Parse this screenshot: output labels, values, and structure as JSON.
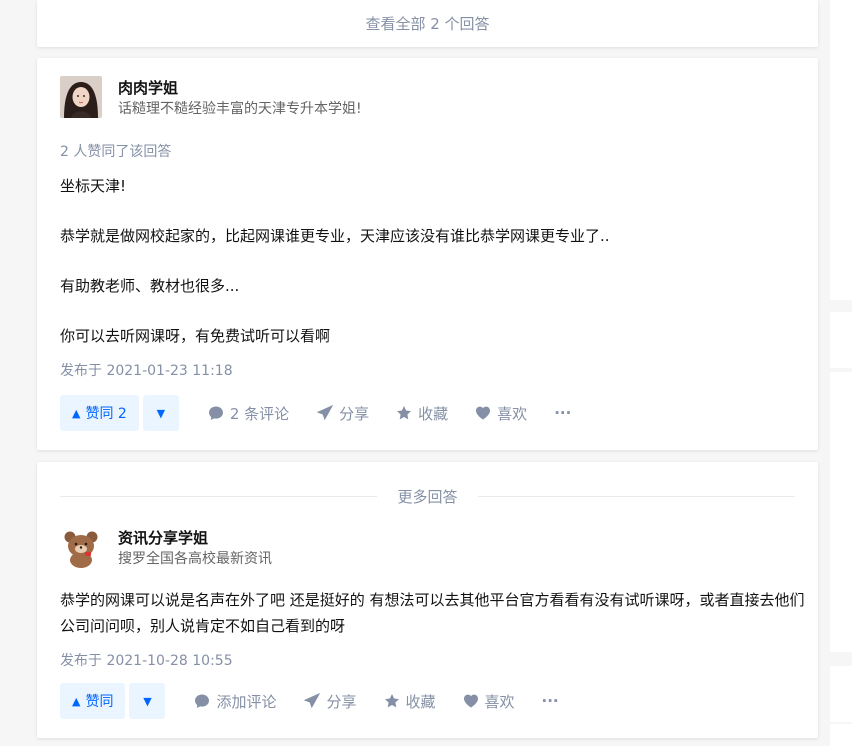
{
  "view_all": {
    "label": "查看全部 2 个回答"
  },
  "answer1": {
    "author_name": "肉肉学姐",
    "author_headline": "话糙理不糙经验丰富的天津专升本学姐!",
    "votes_text": "2 人赞同了该回答",
    "paragraphs": [
      "坐标天津!",
      "恭学就是做网校起家的，比起网课谁更专业，天津应该没有谁比恭学网课更专业了..",
      "有助教老师、教材也很多...",
      "你可以去听网课呀，有免费试听可以看啊"
    ],
    "pub_time": "发布于 2021-01-23 11:18",
    "actions": {
      "vote_up": "赞同 2",
      "comment": "2 条评论",
      "share": "分享",
      "collect": "收藏",
      "like": "喜欢",
      "more": "···"
    }
  },
  "more_answers": {
    "label": "更多回答"
  },
  "answer2": {
    "author_name": "资讯分享学姐",
    "author_headline": "搜罗全国各高校最新资讯",
    "paragraphs": [
      "恭学的网课可以说是名声在外了吧 还是挺好的 有想法可以去其他平台官方看看有没有试听课呀，或者直接去他们公司问问呗，别人说肯定不如自己看到的呀"
    ],
    "pub_time": "发布于 2021-10-28 10:55",
    "actions": {
      "vote_up": "赞同",
      "comment": "添加评论",
      "share": "分享",
      "collect": "收藏",
      "like": "喜欢",
      "more": "···"
    }
  },
  "colors": {
    "accent": "#0066ff",
    "accent_bg": "#ebf5ff",
    "muted": "#8590a6",
    "page_bg": "#f6f6f6"
  }
}
